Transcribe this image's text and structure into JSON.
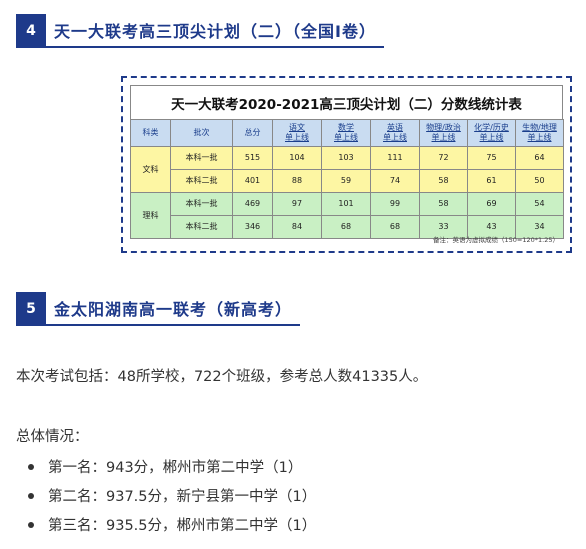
{
  "section4": {
    "number": "4",
    "title": "天一大联考高三顶尖计划（二）（全国Ⅰ卷）"
  },
  "table": {
    "title": "天一大联考2020-2021高三顶尖计划（二）分数线统计表",
    "headers": [
      "科类",
      "批次",
      "总分",
      "语文\n单上线",
      "数学\n单上线",
      "英语\n单上线",
      "物理/政治\n单上线",
      "化学/历史\n单上线",
      "生物/地理\n单上线"
    ],
    "groups": [
      {
        "category": "文科",
        "rows": [
          [
            "本科一批",
            "515",
            "104",
            "103",
            "111",
            "72",
            "75",
            "64"
          ],
          [
            "本科二批",
            "401",
            "88",
            "59",
            "74",
            "58",
            "61",
            "50"
          ]
        ]
      },
      {
        "category": "理科",
        "rows": [
          [
            "本科一批",
            "469",
            "97",
            "101",
            "99",
            "58",
            "69",
            "54"
          ],
          [
            "本科二批",
            "346",
            "84",
            "68",
            "68",
            "33",
            "43",
            "34"
          ]
        ]
      }
    ],
    "note": "备注：英语为虚拟成绩（150=120*1.25）"
  },
  "section5": {
    "number": "5",
    "title": "金太阳湖南高一联考（新高考）"
  },
  "intro": "本次考试包括：48所学校，722个班级，参考总人数41335人。",
  "overall_label": "总体情况：",
  "ranks": [
    "第一名：943分，郴州市第二中学（1）",
    "第二名：937.5分，新宁县第一中学（1）",
    "第三名：935.5分，郴州市第二中学（1）"
  ],
  "colors": {
    "accent": "#1e3a8a",
    "header_bg": "#c9dcf1",
    "arts_bg": "#fdf6a3",
    "science_bg": "#c9f0c4"
  }
}
